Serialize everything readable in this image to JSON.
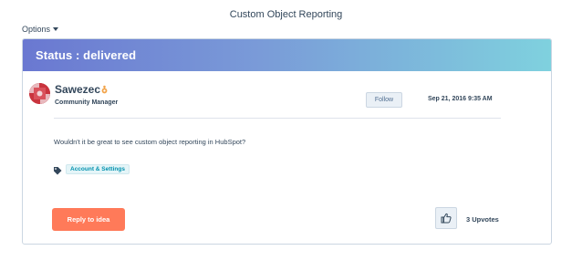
{
  "page": {
    "title": "Custom Object Reporting",
    "options_label": "Options"
  },
  "idea": {
    "status_label": "Status : delivered",
    "author": {
      "name": "Sawezec",
      "role": "Community Manager"
    },
    "follow_label": "Follow",
    "date": "Sep 21, 2016 9:35 AM",
    "body": "Wouldn't it be great to see custom object reporting in HubSpot?",
    "tags": [
      "Account & Settings"
    ],
    "reply_label": "Reply to idea",
    "upvotes_label": "3 Upvotes"
  },
  "colors": {
    "status_gradient_start": "#6a78d1",
    "status_gradient_end": "#7fd1de",
    "reply_button": "#ff7a59",
    "tag_text": "#0091ae",
    "text": "#33475b"
  },
  "icons": {
    "avatar": "hubspot-sprocket-avatar",
    "badge": "orange-sprocket-badge-icon",
    "tag": "tag-icon",
    "upvote": "thumbs-up-icon",
    "options_caret": "caret-down-icon"
  }
}
